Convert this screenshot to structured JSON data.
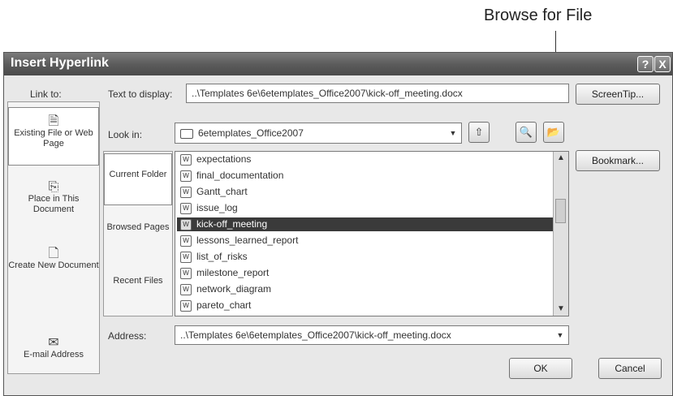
{
  "callout": "Browse for File",
  "dialog": {
    "title": "Insert Hyperlink",
    "help_glyph": "?",
    "close_glyph": "X"
  },
  "link_to": {
    "label": "Link to:",
    "items": [
      {
        "label": "Existing File or Web Page",
        "icon": "existing-file-icon",
        "glyph": "🗎"
      },
      {
        "label": "Place in This Document",
        "icon": "place-in-document-icon",
        "glyph": "⎘"
      },
      {
        "label": "Create New Document",
        "icon": "new-document-icon",
        "glyph": "🗋"
      },
      {
        "label": "E-mail Address",
        "icon": "email-icon",
        "glyph": "✉"
      }
    ],
    "selected": "Existing File or Web Page"
  },
  "text_to_display": {
    "label": "Text to display:",
    "value": "..\\Templates 6e\\6etemplates_Office2007\\kick-off_meeting.docx"
  },
  "look_in": {
    "label": "Look in:",
    "value": "6etemplates_Office2007"
  },
  "subnav": [
    {
      "label": "Current Folder"
    },
    {
      "label": "Browsed Pages"
    },
    {
      "label": "Recent Files"
    }
  ],
  "files": [
    "expectations",
    "final_documentation",
    "Gantt_chart",
    "issue_log",
    "kick-off_meeting",
    "lessons_learned_report",
    "list_of_risks",
    "milestone_report",
    "network_diagram",
    "pareto_chart"
  ],
  "selected_file": "kick-off_meeting",
  "address": {
    "label": "Address:",
    "value": "..\\Templates 6e\\6etemplates_Office2007\\kick-off_meeting.docx"
  },
  "buttons": {
    "screentip": "ScreenTip...",
    "bookmark": "Bookmark...",
    "ok": "OK",
    "cancel": "Cancel"
  }
}
